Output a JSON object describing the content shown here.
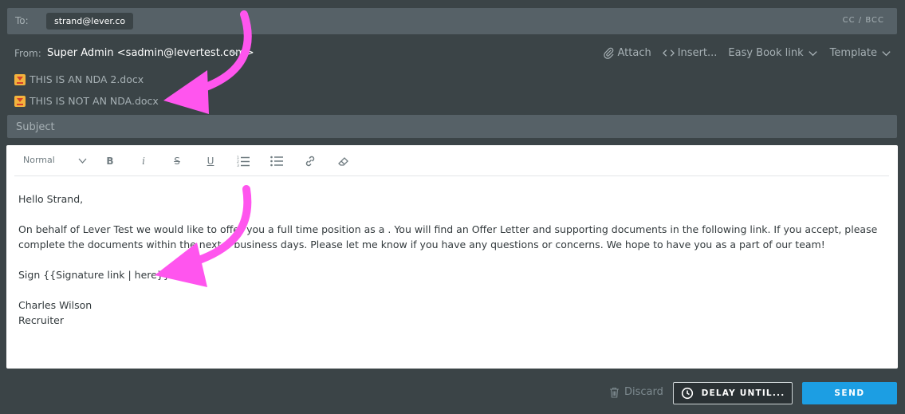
{
  "to": {
    "label": "To:",
    "recipient": "strand@lever.co",
    "cc_bcc": "CC / BCC"
  },
  "from": {
    "label": "From:",
    "value": "Super Admin <sadmin@levertest.com>"
  },
  "tools": {
    "attach": "Attach",
    "insert": "Insert...",
    "easy_book": "Easy Book link",
    "template": "Template"
  },
  "attachments": [
    {
      "name": "THIS IS AN NDA 2.docx"
    },
    {
      "name": "THIS IS NOT AN NDA.docx"
    }
  ],
  "subject": {
    "placeholder": "Subject",
    "value": ""
  },
  "editor": {
    "format_select": "Normal",
    "toolbar_icons": [
      "bold-icon",
      "italic-icon",
      "strikethrough-icon",
      "underline-icon",
      "ordered-list-icon",
      "bullet-list-icon",
      "link-icon",
      "clear-format-icon"
    ],
    "body": {
      "greeting": "Hello Strand,",
      "paragraph1": "On behalf of Lever Test we would like to offer you a full time position as a . You will find an Offer Letter and supporting documents in the following link. If you accept, please complete the documents within the next 2 business days. Please let me know if you have any questions or concerns. We hope to have you as a part of our team!",
      "sign_line": "Sign {{Signature link | here}}",
      "signature_name": "Charles Wilson",
      "signature_title": "Recruiter"
    }
  },
  "footer": {
    "discard": "Discard",
    "delay": "DELAY UNTIL...",
    "send": "SEND"
  },
  "colors": {
    "background": "#3b4447",
    "field": "#566167",
    "send_button": "#1c9ee3",
    "annotation_arrow": "#ff55ee"
  }
}
